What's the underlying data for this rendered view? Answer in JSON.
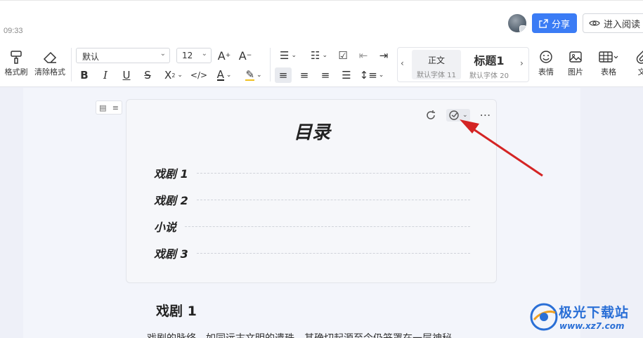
{
  "header": {
    "time": "09:33",
    "share_label": "分享",
    "read_label": "进入阅读"
  },
  "toolbar": {
    "format_painter_label": "格式刷",
    "clear_format_label": "清除格式",
    "font_family": "默认",
    "font_size": "12",
    "styles": [
      {
        "name": "正文",
        "sub": "默认字体 11"
      },
      {
        "name": "标题1",
        "sub": "默认字体 20"
      }
    ],
    "emoji_label": "表情",
    "image_label": "图片",
    "table_label": "表格",
    "more_label": "文"
  },
  "toc": {
    "title": "目录",
    "items": [
      "戏剧 1",
      "戏剧 2",
      "小说",
      "戏剧 3"
    ]
  },
  "document": {
    "heading": "戏剧 1",
    "body": "戏剧的脉络，如同远古文明的遗珠，其确切起源至今仍笼罩在一层神秘"
  },
  "watermark": {
    "name": "极光下载站",
    "url": "www.xz7.com"
  },
  "colors": {
    "accent": "#3b7cf5",
    "arrow": "#d42424"
  }
}
